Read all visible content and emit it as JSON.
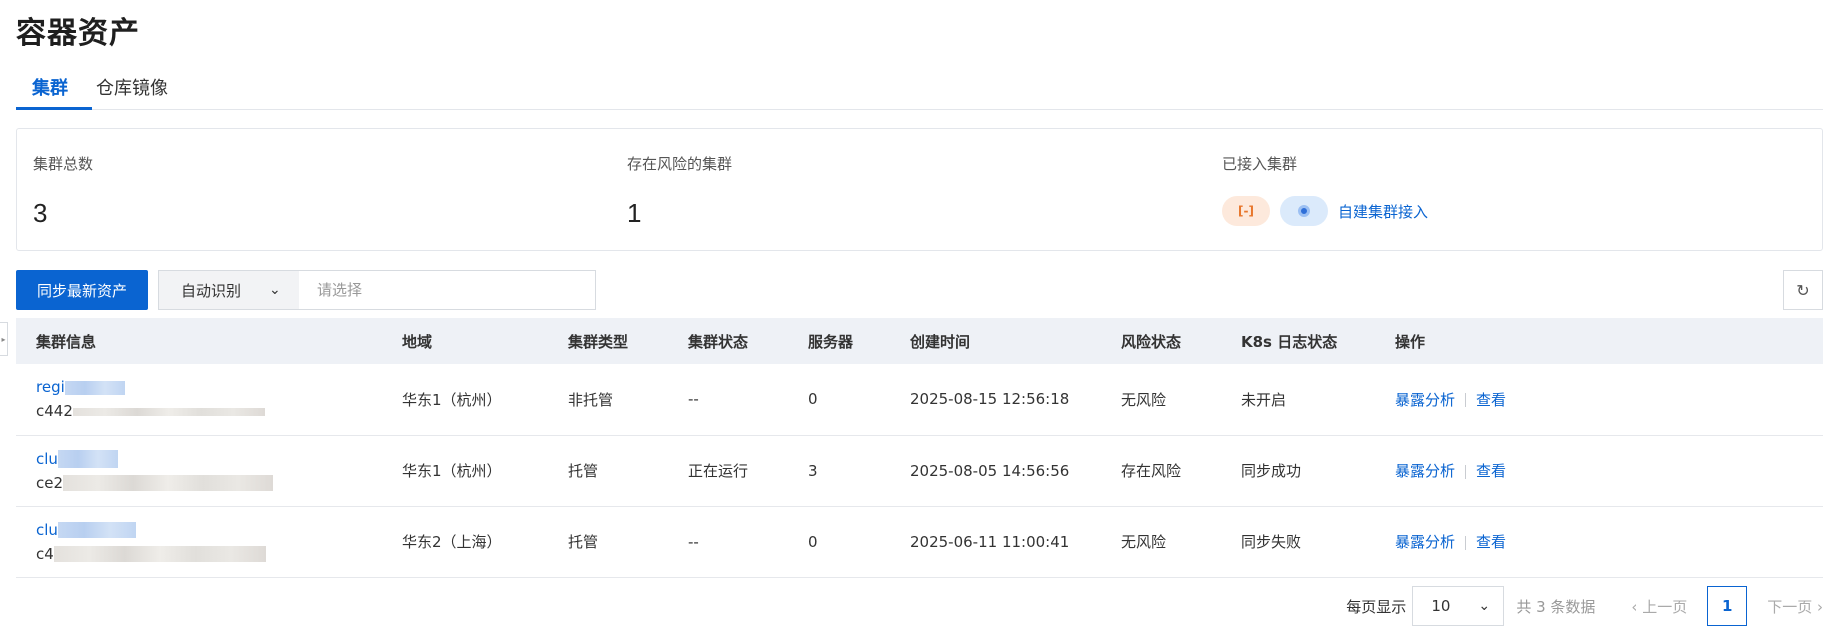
{
  "page": {
    "title": "容器资产"
  },
  "tabs": [
    {
      "label": "集群",
      "active": true
    },
    {
      "label": "仓库镜像",
      "active": false
    }
  ],
  "stats": {
    "total_label": "集群总数",
    "total_value": "3",
    "risk_label": "存在风险的集群",
    "risk_value": "1",
    "connected_label": "已接入集群",
    "connect_link": "自建集群接入"
  },
  "toolbar": {
    "sync_button": "同步最新资产",
    "filter_select": "自动识别",
    "filter_placeholder": "请选择"
  },
  "table": {
    "columns": [
      "集群信息",
      "地域",
      "集群类型",
      "集群状态",
      "服务器",
      "创建时间",
      "风险状态",
      "K8s 日志状态",
      "操作"
    ],
    "rows": [
      {
        "name": "regi",
        "id": "c442",
        "region": "华东1（杭州）",
        "type": "非托管",
        "status": "--",
        "servers": "0",
        "created": "2025-08-15 12:56:18",
        "risk": "无风险",
        "log": "未开启",
        "op1": "暴露分析",
        "op2": "查看"
      },
      {
        "name": "clu",
        "id": "ce2",
        "region": "华东1（杭州）",
        "type": "托管",
        "status": "正在运行",
        "servers": "3",
        "created": "2025-08-05 14:56:56",
        "risk": "存在风险",
        "log": "同步成功",
        "op1": "暴露分析",
        "op2": "查看"
      },
      {
        "name": "clu",
        "id": "c4",
        "region": "华东2（上海）",
        "type": "托管",
        "status": "--",
        "servers": "0",
        "created": "2025-06-11 11:00:41",
        "risk": "无风险",
        "log": "同步失败",
        "op1": "暴露分析",
        "op2": "查看"
      }
    ]
  },
  "pagination": {
    "page_size_label": "每页显示",
    "page_size": "10",
    "total_text": "共 3 条数据",
    "prev": "上一页",
    "current": "1",
    "next": "下一页"
  },
  "colors": {
    "primary": "#0a64d1",
    "safe": "#2a9d3a",
    "danger": "#d9251c"
  }
}
